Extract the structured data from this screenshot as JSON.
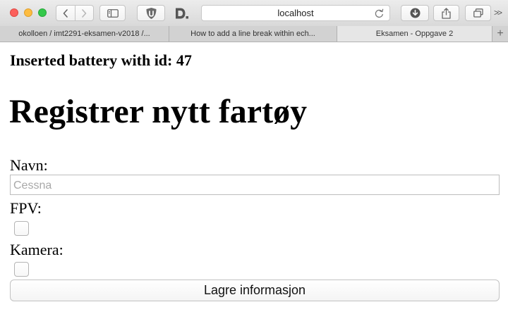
{
  "browser": {
    "address_url": "localhost",
    "overflow_label": ">>",
    "new_tab_label": "+",
    "tabs": [
      {
        "label": "okolloen / imt2291-eksamen-v2018 /..."
      },
      {
        "label": "How to add a line break within ech..."
      },
      {
        "label": "Eksamen - Oppgave 2",
        "active": true
      }
    ],
    "colors": {
      "close": "#fc605c",
      "minimize": "#fdbc40",
      "maximize": "#34c84a"
    }
  },
  "page": {
    "status_message": "Inserted battery with id: 47",
    "heading": "Registrer nytt fartøy",
    "form": {
      "name_label": "Navn:",
      "name_placeholder": "Cessna",
      "name_value": "",
      "fpv_label": "FPV:",
      "fpv_checked": false,
      "camera_label": "Kamera:",
      "camera_checked": false,
      "submit_label": "Lagre informasjon"
    }
  }
}
